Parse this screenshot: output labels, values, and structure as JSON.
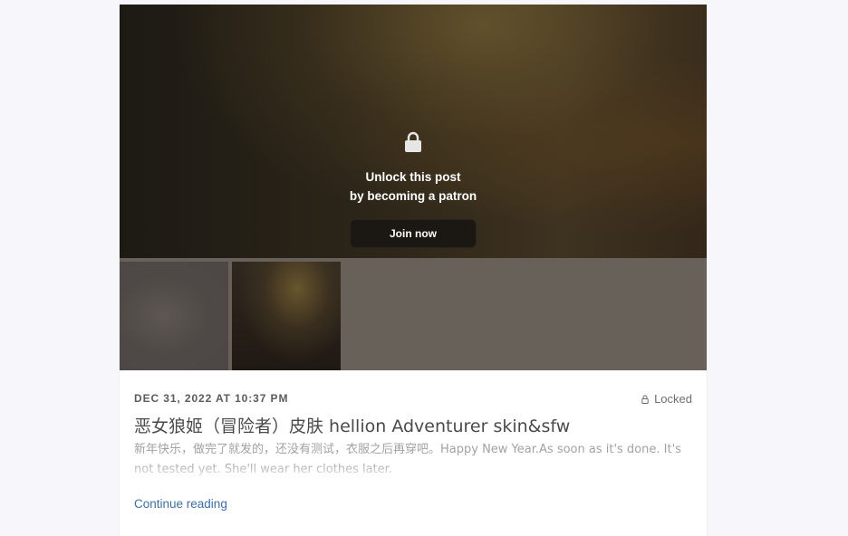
{
  "paywall": {
    "icon": "lock-icon",
    "line1": "Unlock this post",
    "line2": "by becoming a patron",
    "join_label": "Join now"
  },
  "gallery": {
    "thumbnails": [
      "blurred-image",
      "blurred-image"
    ]
  },
  "post": {
    "date": "DEC 31, 2022 AT 10:37 PM",
    "status_icon": "lock-icon",
    "status": "Locked",
    "title": "恶女狼姬（冒险者）皮肤 hellion Adventurer skin&sfw",
    "excerpt": "新年快乐，做完了就发的，还没有测试，衣服之后再穿吧。Happy New Year.As soon as it's done. It's not tested yet. She'll wear her clothes later.",
    "continue_label": "Continue reading"
  },
  "colors": {
    "page_background": "#f7f7fb",
    "button_background": "#1b1713",
    "link": "#3a6fb0",
    "gallery_background": "#67615a"
  }
}
